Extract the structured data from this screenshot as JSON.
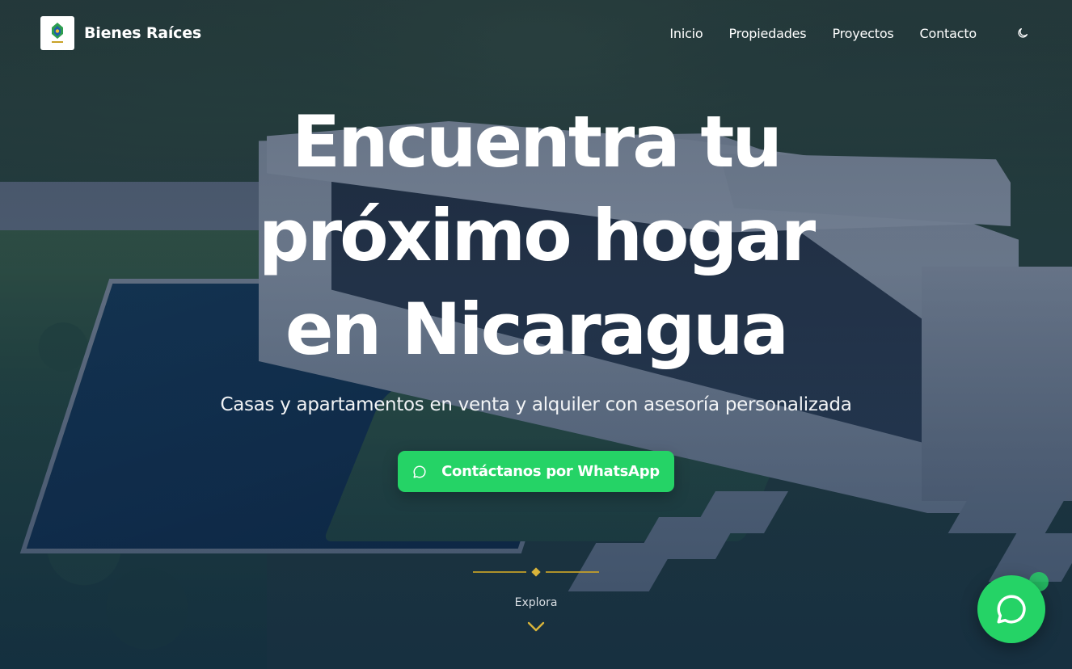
{
  "header": {
    "brand_name": "Bienes Raíces",
    "nav": [
      {
        "label": "Inicio"
      },
      {
        "label": "Propiedades"
      },
      {
        "label": "Proyectos"
      },
      {
        "label": "Contacto"
      }
    ],
    "theme_toggle_icon": "moon-icon"
  },
  "hero": {
    "title_lines": [
      "Encuentra tu",
      "próximo hogar",
      "en Nicaragua"
    ],
    "subtitle": "Casas y apartamentos en venta y alquiler con asesoría personalizada",
    "cta": {
      "label": "Contáctanos por WhatsApp",
      "icon": "whatsapp-icon"
    }
  },
  "scroll": {
    "label": "Explora",
    "icon": "chevron-down-icon"
  },
  "floating": {
    "icon": "whatsapp-icon"
  },
  "colors": {
    "accent_green": "#25d366",
    "gold": "#d9b43a",
    "overlay": "#16304e"
  }
}
